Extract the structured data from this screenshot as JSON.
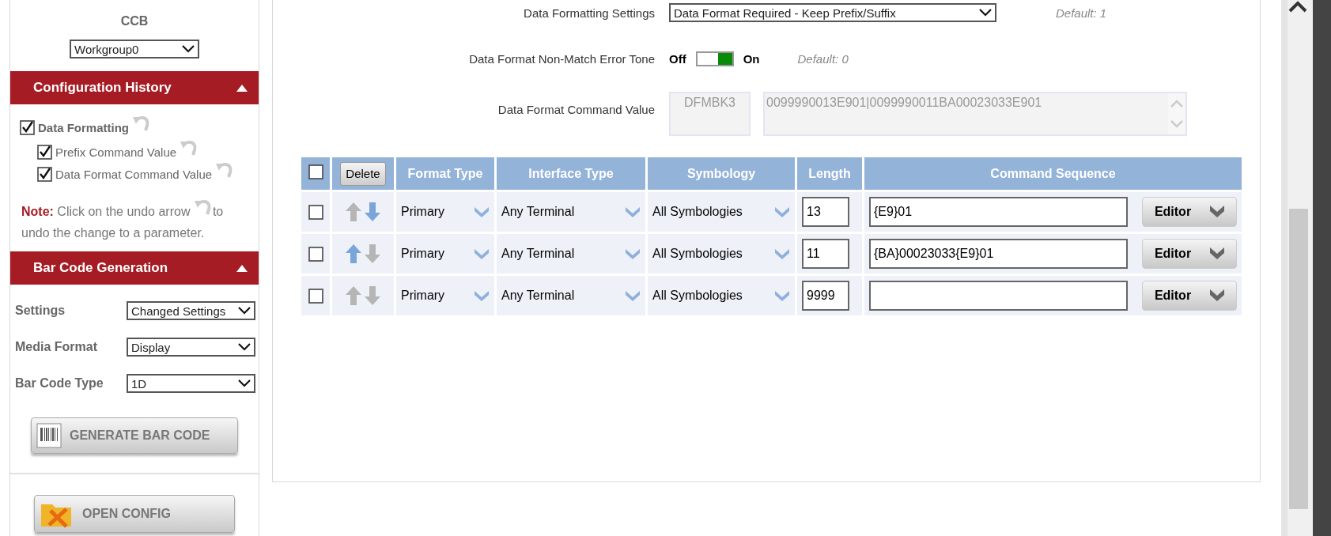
{
  "sidebar": {
    "device_title": "CCB",
    "workgroup_select": {
      "value": "Workgroup0"
    },
    "configuration_history": {
      "title": "Configuration History",
      "expanded": true,
      "items": [
        {
          "label": "Data Formatting",
          "checked": true,
          "children": [
            {
              "label": "Prefix Command Value",
              "checked": true
            },
            {
              "label": "Data Format Command Value",
              "checked": true
            }
          ]
        }
      ],
      "note": {
        "label": "Note:",
        "before": "Click on the undo arrow",
        "after": "to undo the change to a parameter."
      }
    },
    "bar_code_generation": {
      "title": "Bar Code Generation",
      "expanded": true,
      "fields": [
        {
          "label": "Settings",
          "value": "Changed Settings"
        },
        {
          "label": "Media Format",
          "value": "Display"
        },
        {
          "label": "Bar Code Type",
          "value": "1D"
        }
      ],
      "generate_button": "GENERATE BAR CODE"
    },
    "open_config_button": "OPEN CONFIG"
  },
  "settings": {
    "data_formatting": {
      "label": "Data Formatting Settings",
      "value": "Data Format Required - Keep Prefix/Suffix",
      "default": "Default: 1"
    },
    "error_tone": {
      "label": "Data Format Non-Match Error Tone",
      "off_label": "Off",
      "on_label": "On",
      "on": true,
      "default": "Default: 0"
    },
    "command_value": {
      "label": "Data Format Command Value",
      "code": "DFMBK3",
      "value": "0099990013E901|0099990011BA00023033E901"
    }
  },
  "table": {
    "all_checked": false,
    "delete_button": "Delete",
    "columns": [
      "Format Type",
      "Interface Type",
      "Symbology",
      "Length",
      "Command Sequence"
    ],
    "rows": [
      {
        "checked": false,
        "up_enabled": false,
        "down_enabled": true,
        "format_type": "Primary",
        "interface_type": "Any Terminal",
        "symbology": "All Symbologies",
        "length": "13",
        "command_sequence": "{E9}01",
        "editor": "Editor"
      },
      {
        "checked": false,
        "up_enabled": true,
        "down_enabled": false,
        "format_type": "Primary",
        "interface_type": "Any Terminal",
        "symbology": "All Symbologies",
        "length": "11",
        "command_sequence": "{BA}00023033{E9}01",
        "editor": "Editor"
      },
      {
        "checked": false,
        "up_enabled": false,
        "down_enabled": false,
        "format_type": "Primary",
        "interface_type": "Any Terminal",
        "symbology": "All Symbologies",
        "length": "9999",
        "command_sequence": "",
        "editor": "Editor"
      }
    ]
  }
}
